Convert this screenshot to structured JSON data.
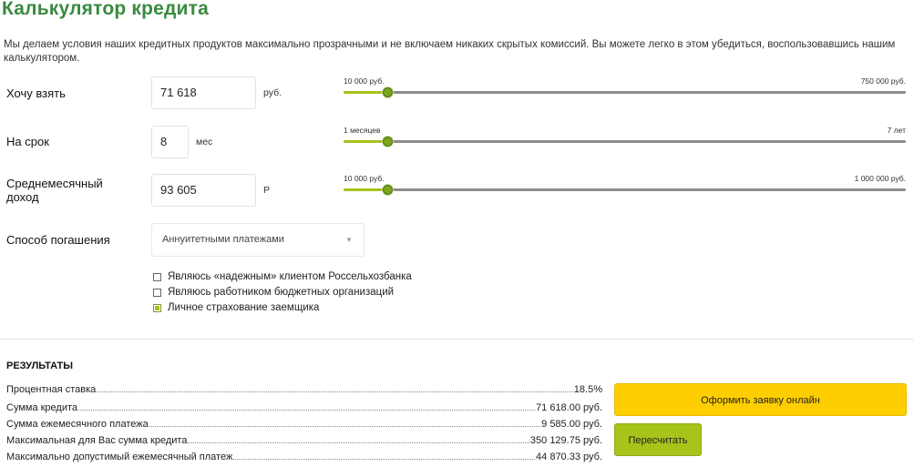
{
  "page": {
    "title": "Калькулятор кредита",
    "intro": "Мы делаем условия наших кредитных продуктов максимально прозрачными и не включаем никаких скрытых комиссий. Вы можете легко в этом убедиться, воспользовавшись нашим калькулятором."
  },
  "colors": {
    "accent_green": "#a6c41a",
    "title_green": "#3a8a3f",
    "apply_button": "#fece00"
  },
  "form": {
    "amount": {
      "label": "Хочу взять",
      "value": "71 618",
      "unit": "руб.",
      "slider_min": "10 000 руб.",
      "slider_max": "750 000 руб.",
      "slider_fraction": 0.08
    },
    "term": {
      "label": "На срок",
      "value": "8",
      "unit": "мес",
      "slider_min": "1 месяцев",
      "slider_max": "7 лет",
      "slider_fraction": 0.08
    },
    "income": {
      "label": "Среднемесячный доход",
      "value": "93 605",
      "unit": "Р",
      "slider_min": "10 000 руб.",
      "slider_max": "1 000 000 руб.",
      "slider_fraction": 0.08
    },
    "repayment": {
      "label": "Способ погашения",
      "selected": "Аннуитетными платежами",
      "arrow_icon": "caret-down-icon"
    },
    "checkboxes": [
      {
        "label": "Являюсь «надежным» клиентом Россельхозбанка",
        "checked": false
      },
      {
        "label": "Являюсь работником бюджетных организаций",
        "checked": false
      },
      {
        "label": "Личное страхование заемщика",
        "checked": true
      }
    ]
  },
  "results": {
    "title": "РЕЗУЛЬТАТЫ",
    "rows": [
      {
        "label": "Процентная ставка",
        "value": "18.5%"
      },
      {
        "label": "Сумма кредита",
        "value": "71 618.00 руб."
      },
      {
        "label": "Сумма ежемесячного платежа",
        "value": "9 585.00 руб."
      },
      {
        "label": "Максимальная для Вас сумма кредита",
        "value": "350 129.75 руб."
      },
      {
        "label": "Максимально допустимый ежемесячный платеж",
        "value": "44 870.33 руб."
      }
    ],
    "apply_button": "Оформить заявку онлайн",
    "recalc_button": "Пересчитать"
  }
}
